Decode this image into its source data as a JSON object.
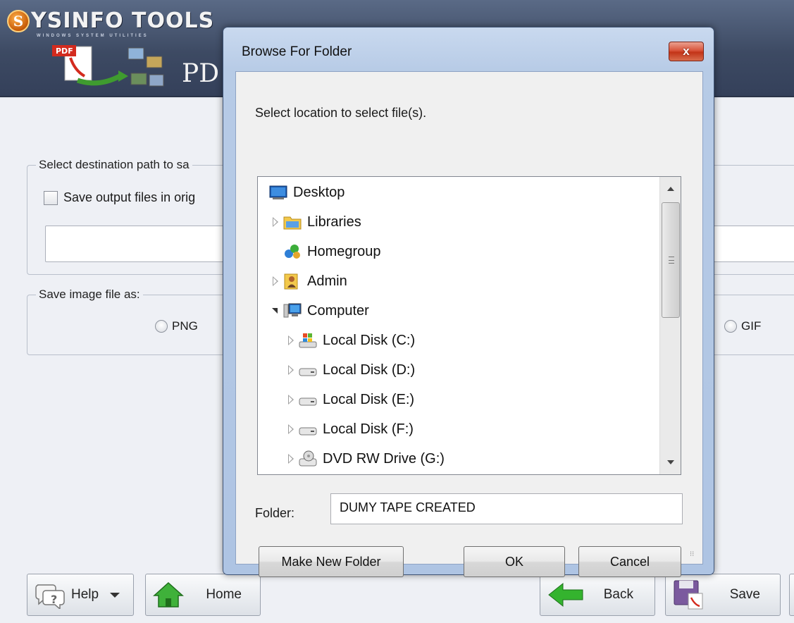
{
  "app": {
    "logo_letter": "S",
    "logo_text": "YSINFO TOOLS",
    "logo_tagline": "WINDOWS SYSTEM UTILITIES",
    "product_title_fragment": "PD",
    "pdf_badge": "PDF",
    "dest_group_legend": "Select destination path to sa",
    "save_original_label": "Save output files in orig",
    "image_group_legend": "Save image file as:",
    "radio_png": "PNG",
    "radio_gif": "GIF",
    "buttons": {
      "help": "Help",
      "home": "Home",
      "back": "Back",
      "save": "Save"
    }
  },
  "dialog": {
    "title": "Browse For Folder",
    "close_label": "x",
    "prompt": "Select location to select file(s).",
    "tree": [
      {
        "label": "Desktop",
        "icon": "desktop-icon",
        "expander": "none",
        "indent": 0
      },
      {
        "label": "Libraries",
        "icon": "libraries-icon",
        "expander": "collapsed",
        "indent": 0
      },
      {
        "label": "Homegroup",
        "icon": "homegroup-icon",
        "expander": "none",
        "indent": 0
      },
      {
        "label": "Admin",
        "icon": "user-folder-icon",
        "expander": "collapsed",
        "indent": 0
      },
      {
        "label": "Computer",
        "icon": "computer-icon",
        "expander": "expanded",
        "indent": 0
      },
      {
        "label": "Local Disk (C:)",
        "icon": "system-drive-icon",
        "expander": "collapsed",
        "indent": 1
      },
      {
        "label": "Local Disk (D:)",
        "icon": "drive-icon",
        "expander": "collapsed",
        "indent": 1
      },
      {
        "label": "Local Disk (E:)",
        "icon": "drive-icon",
        "expander": "collapsed",
        "indent": 1
      },
      {
        "label": "Local Disk (F:)",
        "icon": "drive-icon",
        "expander": "collapsed",
        "indent": 1
      },
      {
        "label": "DVD RW Drive (G:)",
        "icon": "dvd-drive-icon",
        "expander": "collapsed",
        "indent": 1
      }
    ],
    "folder_label": "Folder:",
    "folder_value": "DUMY TAPE CREATED",
    "make_new_folder": "Make New Folder",
    "ok": "OK",
    "cancel": "Cancel"
  },
  "colors": {
    "header": "#3d4a63",
    "dialog_frame": "#aec4e3",
    "close_red": "#c23418"
  }
}
